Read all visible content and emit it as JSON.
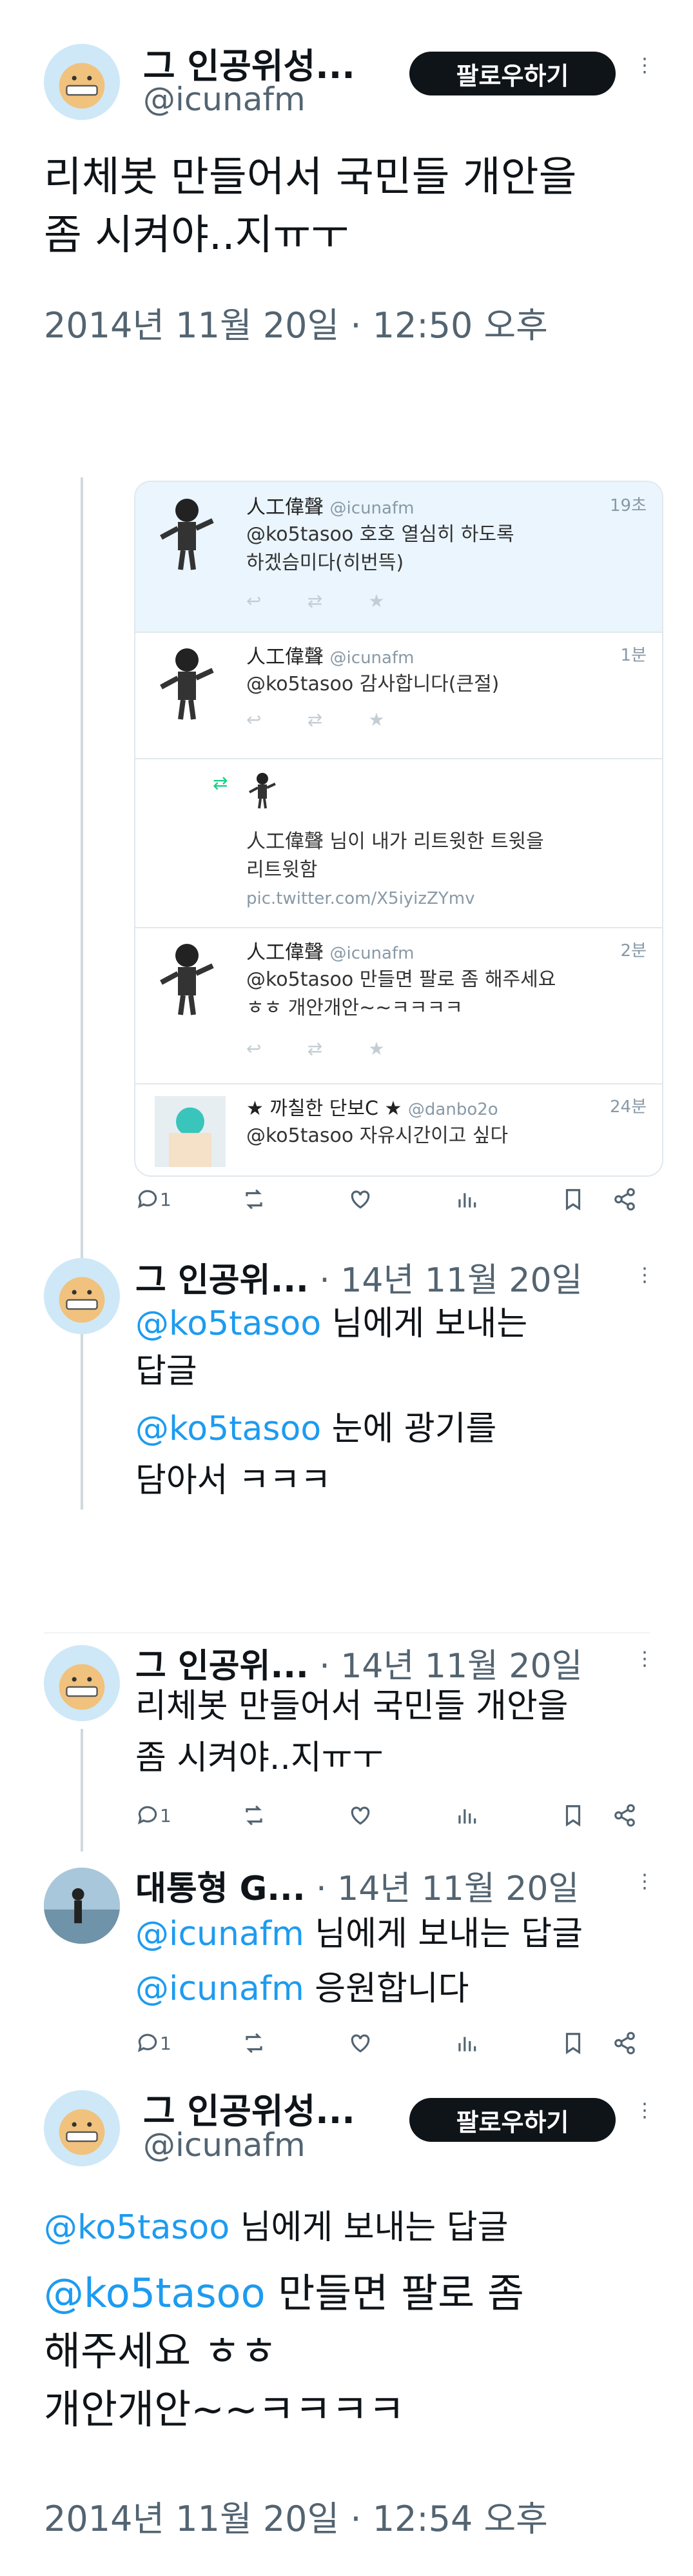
{
  "tweet1": {
    "name": "그 인공위성...",
    "handle": "@icunafm",
    "follow": "팔로우하기",
    "text_line1": "리체봇 만들어서 국민들 개안을",
    "text_line2": "좀 시켜야..지ㅠㅜ",
    "timestamp": "2014년 11월 20일 · 12:50 오후"
  },
  "embed": {
    "rows": [
      {
        "name": "人工偉聲",
        "handle": "@icunafm",
        "time": "19초",
        "line1": "@ko5tasoo 호호 열심히 하도록",
        "line2": "하겠슴미다(히번뜩)"
      },
      {
        "name": "人工偉聲",
        "handle": "@icunafm",
        "time": "1분",
        "line1": "@ko5tasoo 감사합니다(큰절)",
        "line2": ""
      },
      {
        "name": "",
        "handle": "",
        "time": "",
        "line1": "人工偉聲 님이 내가 리트윗한 트윗을",
        "line2": "리트윗함",
        "line3": "pic.twitter.com/X5iyizZYmv"
      },
      {
        "name": "人工偉聲",
        "handle": "@icunafm",
        "time": "2분",
        "line1": "@ko5tasoo 만들면 팔로 좀 해주세요",
        "line2": "ㅎㅎ 개안개안~~ㅋㅋㅋㅋ"
      },
      {
        "name": "★ 까칠한 단보C ★",
        "handle": "@danbo2o",
        "time": "24분",
        "line1": "@ko5tasoo 자유시간이고 싶다",
        "line2": ""
      }
    ]
  },
  "tweet1_actions": {
    "reply_count": "1"
  },
  "reply1": {
    "name": "그 인공위...",
    "meta": "· 14년 11월 20일",
    "reply_to_handle": "@ko5tasoo",
    "reply_to_suffix": " 님에게 보내는",
    "reply_to_line2": "답글",
    "mention": "@ko5tasoo",
    "text_rest": " 눈에 광기를",
    "text_line2": "담아서 ㅋㅋㅋ"
  },
  "tweet2": {
    "name": "그 인공위...",
    "meta": "· 14년 11월 20일",
    "text_line1": "리체봇 만들어서 국민들 개안을",
    "text_line2": "좀 시켜야..지ㅠㅜ",
    "reply_count": "1"
  },
  "reply2": {
    "name": "대통형 G...",
    "meta": "· 14년 11월 20일",
    "reply_to_handle": "@icunafm",
    "reply_to_suffix": " 님에게 보내는 답글",
    "mention": "@icunafm",
    "text_rest": " 응원합니다",
    "reply_count": "1"
  },
  "tweet3": {
    "name": "그 인공위성...",
    "handle": "@icunafm",
    "follow": "팔로우하기",
    "reply_to_handle": "@ko5tasoo",
    "reply_to_suffix": " 님에게 보내는 답글",
    "mention": "@ko5tasoo",
    "text_rest": " 만들면 팔로 좀",
    "text_line2": "해주세요 ㅎㅎ",
    "text_line3": "개안개안~~ㅋㅋㅋㅋ",
    "timestamp": "2014년 11월 20일 · 12:54 오후"
  },
  "colors": {
    "link": "#1d9bf0",
    "text": "#0f1419",
    "muted": "#536471",
    "button": "#0f1419"
  }
}
